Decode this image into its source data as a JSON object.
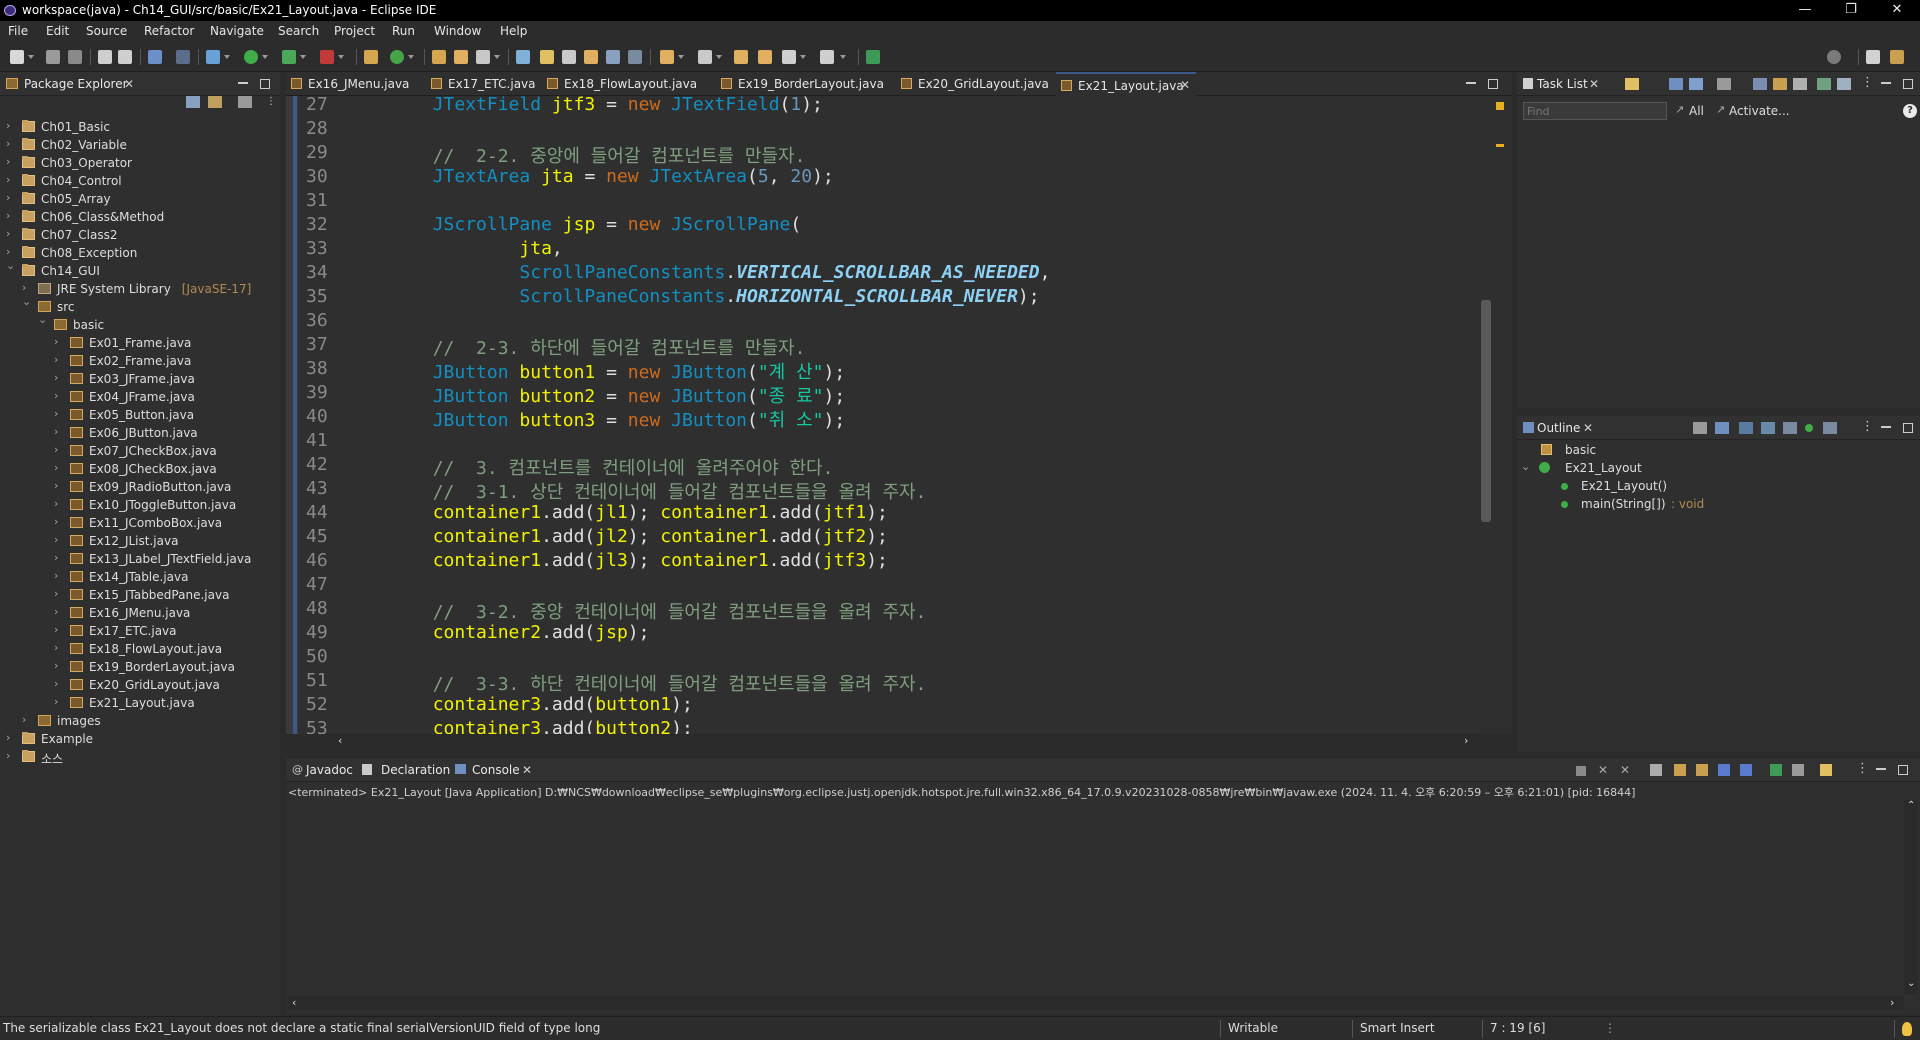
{
  "window": {
    "title": "workspace(java) - Ch14_GUI/src/basic/Ex21_Layout.java - Eclipse IDE",
    "minimize": "—",
    "maximize": "❐",
    "close": "✕"
  },
  "menu": [
    "File",
    "Edit",
    "Source",
    "Refactor",
    "Navigate",
    "Search",
    "Project",
    "Run",
    "Window",
    "Help"
  ],
  "package_explorer": {
    "title": "Package Explorer",
    "items": [
      {
        "label": "Ch01_Basic",
        "indent": 0,
        "arrow": "›",
        "icon": "proj"
      },
      {
        "label": "Ch02_Variable",
        "indent": 0,
        "arrow": "›",
        "icon": "proj"
      },
      {
        "label": "Ch03_Operator",
        "indent": 0,
        "arrow": "›",
        "icon": "proj"
      },
      {
        "label": "Ch04_Control",
        "indent": 0,
        "arrow": "›",
        "icon": "proj"
      },
      {
        "label": "Ch05_Array",
        "indent": 0,
        "arrow": "›",
        "icon": "proj"
      },
      {
        "label": "Ch06_Class&Method",
        "indent": 0,
        "arrow": "›",
        "icon": "proj"
      },
      {
        "label": "Ch07_Class2",
        "indent": 0,
        "arrow": "›",
        "icon": "proj"
      },
      {
        "label": "Ch08_Exception",
        "indent": 0,
        "arrow": "›",
        "icon": "proj"
      },
      {
        "label": "Ch14_GUI",
        "indent": 0,
        "arrow": "⌄",
        "icon": "proj"
      },
      {
        "label": "JRE System Library",
        "suffix": "[JavaSE-17]",
        "indent": 1,
        "arrow": "›",
        "icon": "lib"
      },
      {
        "label": "src",
        "indent": 1,
        "arrow": "⌄",
        "icon": "pkg"
      },
      {
        "label": "basic",
        "indent": 2,
        "arrow": "⌄",
        "icon": "pkg"
      },
      {
        "label": "Ex01_Frame.java",
        "indent": 3,
        "arrow": "›",
        "icon": "jfile"
      },
      {
        "label": "Ex02_Frame.java",
        "indent": 3,
        "arrow": "›",
        "icon": "jfile"
      },
      {
        "label": "Ex03_JFrame.java",
        "indent": 3,
        "arrow": "›",
        "icon": "jfile"
      },
      {
        "label": "Ex04_JFrame.java",
        "indent": 3,
        "arrow": "›",
        "icon": "jfile"
      },
      {
        "label": "Ex05_Button.java",
        "indent": 3,
        "arrow": "›",
        "icon": "jfile"
      },
      {
        "label": "Ex06_JButton.java",
        "indent": 3,
        "arrow": "›",
        "icon": "jfile"
      },
      {
        "label": "Ex07_JCheckBox.java",
        "indent": 3,
        "arrow": "›",
        "icon": "jfile"
      },
      {
        "label": "Ex08_JCheckBox.java",
        "indent": 3,
        "arrow": "›",
        "icon": "jfile"
      },
      {
        "label": "Ex09_JRadioButton.java",
        "indent": 3,
        "arrow": "›",
        "icon": "jfile"
      },
      {
        "label": "Ex10_JToggleButton.java",
        "indent": 3,
        "arrow": "›",
        "icon": "jfile"
      },
      {
        "label": "Ex11_JComboBox.java",
        "indent": 3,
        "arrow": "›",
        "icon": "jfile"
      },
      {
        "label": "Ex12_JList.java",
        "indent": 3,
        "arrow": "›",
        "icon": "jfile"
      },
      {
        "label": "Ex13_JLabel_JTextField.java",
        "indent": 3,
        "arrow": "›",
        "icon": "jfile"
      },
      {
        "label": "Ex14_JTable.java",
        "indent": 3,
        "arrow": "›",
        "icon": "jfile"
      },
      {
        "label": "Ex15_JTabbedPane.java",
        "indent": 3,
        "arrow": "›",
        "icon": "jfile"
      },
      {
        "label": "Ex16_JMenu.java",
        "indent": 3,
        "arrow": "›",
        "icon": "jfile"
      },
      {
        "label": "Ex17_ETC.java",
        "indent": 3,
        "arrow": "›",
        "icon": "jfile"
      },
      {
        "label": "Ex18_FlowLayout.java",
        "indent": 3,
        "arrow": "›",
        "icon": "jfile"
      },
      {
        "label": "Ex19_BorderLayout.java",
        "indent": 3,
        "arrow": "›",
        "icon": "jfile"
      },
      {
        "label": "Ex20_GridLayout.java",
        "indent": 3,
        "arrow": "›",
        "icon": "jfile"
      },
      {
        "label": "Ex21_Layout.java",
        "indent": 3,
        "arrow": "›",
        "icon": "jfile"
      },
      {
        "label": "images",
        "indent": 1,
        "arrow": "›",
        "icon": "pkg"
      },
      {
        "label": "Example",
        "indent": 0,
        "arrow": "›",
        "icon": "proj"
      },
      {
        "label": "소스",
        "indent": 0,
        "arrow": "›",
        "icon": "proj"
      }
    ]
  },
  "editor_tabs": [
    {
      "label": "Ex16_JMenu.java",
      "active": false
    },
    {
      "label": "Ex17_ETC.java",
      "active": false
    },
    {
      "label": "Ex18_FlowLayout.java",
      "active": false
    },
    {
      "label": "Ex19_BorderLayout.java",
      "active": false
    },
    {
      "label": "Ex20_GridLayout.java",
      "active": false
    },
    {
      "label": "Ex21_Layout.java",
      "active": true
    }
  ],
  "code_lines": [
    {
      "num": "27",
      "tokens": [
        [
          "        ",
          ""
        ],
        [
          "JTextField",
          "ty"
        ],
        [
          " ",
          ""
        ],
        [
          "jtf3",
          "var"
        ],
        [
          " = ",
          ""
        ],
        [
          "new",
          "kw"
        ],
        [
          " ",
          ""
        ],
        [
          "JTextField",
          "ty"
        ],
        [
          "(",
          ""
        ],
        [
          "1",
          "num"
        ],
        [
          ");",
          ""
        ]
      ]
    },
    {
      "num": "28",
      "tokens": []
    },
    {
      "num": "29",
      "tokens": [
        [
          "        ",
          ""
        ],
        [
          "//  2-2. 중앙에 들어갈 컴포넌트를 만들자.",
          "cm"
        ]
      ]
    },
    {
      "num": "30",
      "tokens": [
        [
          "        ",
          ""
        ],
        [
          "JTextArea",
          "ty"
        ],
        [
          " ",
          ""
        ],
        [
          "jta",
          "var"
        ],
        [
          " = ",
          ""
        ],
        [
          "new",
          "kw"
        ],
        [
          " ",
          ""
        ],
        [
          "JTextArea",
          "ty"
        ],
        [
          "(",
          ""
        ],
        [
          "5",
          "num"
        ],
        [
          ", ",
          ""
        ],
        [
          "20",
          "num"
        ],
        [
          ");",
          ""
        ]
      ]
    },
    {
      "num": "31",
      "tokens": []
    },
    {
      "num": "32",
      "tokens": [
        [
          "        ",
          ""
        ],
        [
          "JScrollPane",
          "ty"
        ],
        [
          " ",
          ""
        ],
        [
          "jsp",
          "var"
        ],
        [
          " = ",
          ""
        ],
        [
          "new",
          "kw"
        ],
        [
          " ",
          ""
        ],
        [
          "JScrollPane",
          "ty"
        ],
        [
          "(",
          ""
        ]
      ]
    },
    {
      "num": "33",
      "tokens": [
        [
          "                ",
          ""
        ],
        [
          "jta",
          "var"
        ],
        [
          ",",
          ""
        ]
      ]
    },
    {
      "num": "34",
      "tokens": [
        [
          "                ",
          ""
        ],
        [
          "ScrollPaneConstants",
          "ty"
        ],
        [
          ".",
          ""
        ],
        [
          "VERTICAL_SCROLLBAR_AS_NEEDED",
          "cst"
        ],
        [
          ",",
          ""
        ]
      ]
    },
    {
      "num": "35",
      "tokens": [
        [
          "                ",
          ""
        ],
        [
          "ScrollPaneConstants",
          "ty"
        ],
        [
          ".",
          ""
        ],
        [
          "HORIZONTAL_SCROLLBAR_NEVER",
          "cst"
        ],
        [
          ");",
          ""
        ]
      ]
    },
    {
      "num": "36",
      "tokens": []
    },
    {
      "num": "37",
      "tokens": [
        [
          "        ",
          ""
        ],
        [
          "//  2-3. 하단에 들어갈 컴포넌트를 만들자.",
          "cm"
        ]
      ]
    },
    {
      "num": "38",
      "tokens": [
        [
          "        ",
          ""
        ],
        [
          "JButton",
          "ty"
        ],
        [
          " ",
          ""
        ],
        [
          "button1",
          "var"
        ],
        [
          " = ",
          ""
        ],
        [
          "new",
          "kw"
        ],
        [
          " ",
          ""
        ],
        [
          "JButton",
          "ty"
        ],
        [
          "(",
          ""
        ],
        [
          "\"계 산\"",
          "str"
        ],
        [
          ");",
          ""
        ]
      ]
    },
    {
      "num": "39",
      "tokens": [
        [
          "        ",
          ""
        ],
        [
          "JButton",
          "ty"
        ],
        [
          " ",
          ""
        ],
        [
          "button2",
          "var"
        ],
        [
          " = ",
          ""
        ],
        [
          "new",
          "kw"
        ],
        [
          " ",
          ""
        ],
        [
          "JButton",
          "ty"
        ],
        [
          "(",
          ""
        ],
        [
          "\"종 료\"",
          "str"
        ],
        [
          ");",
          ""
        ]
      ]
    },
    {
      "num": "40",
      "tokens": [
        [
          "        ",
          ""
        ],
        [
          "JButton",
          "ty"
        ],
        [
          " ",
          ""
        ],
        [
          "button3",
          "var"
        ],
        [
          " = ",
          ""
        ],
        [
          "new",
          "kw"
        ],
        [
          " ",
          ""
        ],
        [
          "JButton",
          "ty"
        ],
        [
          "(",
          ""
        ],
        [
          "\"취 소\"",
          "str"
        ],
        [
          ");",
          ""
        ]
      ]
    },
    {
      "num": "41",
      "tokens": []
    },
    {
      "num": "42",
      "tokens": [
        [
          "        ",
          ""
        ],
        [
          "//  3. 컴포넌트를 컨테이너에 올려주어야 한다.",
          "cm"
        ]
      ]
    },
    {
      "num": "43",
      "tokens": [
        [
          "        ",
          ""
        ],
        [
          "//  3-1. 상단 컨테이너에 들어갈 컴포넌트들을 올려 주자.",
          "cm"
        ]
      ]
    },
    {
      "num": "44",
      "tokens": [
        [
          "        ",
          ""
        ],
        [
          "container1",
          "var"
        ],
        [
          ".add(",
          ""
        ],
        [
          "jl1",
          "var"
        ],
        [
          "); ",
          ""
        ],
        [
          "container1",
          "var"
        ],
        [
          ".add(",
          ""
        ],
        [
          "jtf1",
          "var"
        ],
        [
          ");",
          ""
        ]
      ]
    },
    {
      "num": "45",
      "tokens": [
        [
          "        ",
          ""
        ],
        [
          "container1",
          "var"
        ],
        [
          ".add(",
          ""
        ],
        [
          "jl2",
          "var"
        ],
        [
          "); ",
          ""
        ],
        [
          "container1",
          "var"
        ],
        [
          ".add(",
          ""
        ],
        [
          "jtf2",
          "var"
        ],
        [
          ");",
          ""
        ]
      ]
    },
    {
      "num": "46",
      "tokens": [
        [
          "        ",
          ""
        ],
        [
          "container1",
          "var"
        ],
        [
          ".add(",
          ""
        ],
        [
          "jl3",
          "var"
        ],
        [
          "); ",
          ""
        ],
        [
          "container1",
          "var"
        ],
        [
          ".add(",
          ""
        ],
        [
          "jtf3",
          "var"
        ],
        [
          ");",
          ""
        ]
      ]
    },
    {
      "num": "47",
      "tokens": []
    },
    {
      "num": "48",
      "tokens": [
        [
          "        ",
          ""
        ],
        [
          "//  3-2. 중앙 컨테이너에 들어갈 컴포넌트들을 올려 주자.",
          "cm"
        ]
      ]
    },
    {
      "num": "49",
      "tokens": [
        [
          "        ",
          ""
        ],
        [
          "container2",
          "var"
        ],
        [
          ".add(",
          ""
        ],
        [
          "jsp",
          "var"
        ],
        [
          ");",
          ""
        ]
      ]
    },
    {
      "num": "50",
      "tokens": []
    },
    {
      "num": "51",
      "tokens": [
        [
          "        ",
          ""
        ],
        [
          "//  3-3. 하단 컨테이너에 들어갈 컴포넌트들을 올려 주자.",
          "cm"
        ]
      ]
    },
    {
      "num": "52",
      "tokens": [
        [
          "        ",
          ""
        ],
        [
          "container3",
          "var"
        ],
        [
          ".add(",
          ""
        ],
        [
          "button1",
          "var"
        ],
        [
          ");",
          ""
        ]
      ]
    },
    {
      "num": "53",
      "tokens": [
        [
          "        ",
          ""
        ],
        [
          "container3",
          "var"
        ],
        [
          ".add(",
          ""
        ],
        [
          "button2",
          "var"
        ],
        [
          ");",
          ""
        ]
      ]
    }
  ],
  "task_list": {
    "title": "Task List",
    "find_placeholder": "Find",
    "all_label": "All",
    "activate_label": "Activate..."
  },
  "outline": {
    "title": "Outline",
    "items": [
      {
        "label": "basic",
        "extra": "",
        "indent": 0
      },
      {
        "label": "Ex21_Layout",
        "extra": "",
        "indent": 0
      },
      {
        "label": "Ex21_Layout()",
        "extra": "",
        "indent": 1
      },
      {
        "label": "main(String[])",
        "extra": " : void",
        "indent": 1
      }
    ]
  },
  "bottom_tabs": [
    {
      "label": "Javadoc",
      "active": false
    },
    {
      "label": "Declaration",
      "active": false
    },
    {
      "label": "Console",
      "active": true
    }
  ],
  "console": {
    "status_line": "<terminated> Ex21_Layout [Java Application] D:₩NCS₩download₩eclipse_se₩plugins₩org.eclipse.justj.openjdk.hotspot.jre.full.win32.x86_64_17.0.9.v20231028-0858₩jre₩bin₩javaw.exe  (2024. 11. 4. 오후 6:20:59 – 오후 6:21:01) [pid: 16844]"
  },
  "status_bar": {
    "message": "The serializable class Ex21_Layout does not declare a static final serialVersionUID field of type long",
    "mode": "Writable",
    "insert": "Smart Insert",
    "position": "7 : 19 [6]"
  },
  "colors": {
    "accent": "#3d5a8a",
    "keyword": "#cc6c1d",
    "type": "#1290c3",
    "comment": "#7f9f7f",
    "string": "#17c6a3",
    "variable": "#f2f200"
  }
}
